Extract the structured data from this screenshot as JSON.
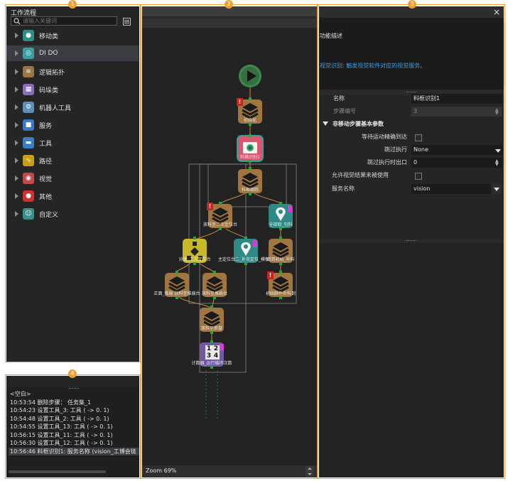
{
  "badges": [
    "1",
    "2",
    "3",
    "4"
  ],
  "workflow": {
    "title": "工作流程",
    "search_placeholder": "请输入关键词",
    "items": [
      {
        "label": "移动类",
        "icon": "location-pin-icon",
        "color": "#2f8f86"
      },
      {
        "label": "DI DO",
        "icon": "dido-icon",
        "color": "#3aa0a0"
      },
      {
        "label": "逻辑拓扑",
        "icon": "layers-icon",
        "color": "#9a7443"
      },
      {
        "label": "码垛类",
        "icon": "palletize-icon",
        "color": "#8a6bb8"
      },
      {
        "label": "机器人工具",
        "icon": "robot-tool-icon",
        "color": "#5e8fb8"
      },
      {
        "label": "服务",
        "icon": "service-icon",
        "color": "#3b78c4"
      },
      {
        "label": "工具",
        "icon": "toolbox-icon",
        "color": "#3a7fbf"
      },
      {
        "label": "路径",
        "icon": "path-icon",
        "color": "#c8a018"
      },
      {
        "label": "视觉",
        "icon": "vision-camera-icon",
        "color": "#c04a4a"
      },
      {
        "label": "其他",
        "icon": "other-icon",
        "color": "#d03030"
      },
      {
        "label": "自定义",
        "icon": "custom-user-icon",
        "color": "#3a8f86"
      }
    ]
  },
  "canvas": {
    "zoom_label": "Zoom 69%",
    "nodes": [
      {
        "label": "初始化"
      },
      {
        "label": "料箱识别1"
      },
      {
        "label": "料框跟踪"
      },
      {
        "label": "放料至二次定位台"
      },
      {
        "label": "全部取_包料"
      },
      {
        "label": "分类_二次定位台"
      },
      {
        "label": "主定位台二_补充定位_模板台"
      },
      {
        "label": "回到初始_补料"
      },
      {
        "label": "正面_推扁 放料至推扁台"
      },
      {
        "label": "放料至推扁台"
      },
      {
        "label": "初始脚件补料到"
      },
      {
        "label": "放料至抓盘"
      },
      {
        "label": "计数器_运行循环次数"
      }
    ],
    "counter_digits": [
      "1",
      "2",
      "3",
      "4"
    ]
  },
  "properties": {
    "section_title": "功能描述",
    "description": "视觉识别: 触发视觉软件对应的视觉服务。",
    "rows": {
      "name_label": "名称",
      "name_value": "料框识别1",
      "step_label": "步骤编号",
      "step_value": "3",
      "group_label": "非移动步骤基本参数",
      "wait_label": "等待运动精确到达",
      "skip_label": "跳过执行",
      "skip_value": "None",
      "skip_exit_label": "跳过执行时出口",
      "skip_exit_value": "0",
      "allow_label": "允许视觉结果未被使用",
      "service_label": "服务名称",
      "service_value": "vision"
    }
  },
  "log": {
    "lines": [
      "<空白>",
      "10:53:54 删除步骤： 任务集_1",
      "10:54:23 设置工具_3: 工具 ( -> 0. 1)",
      "10:54:48 设置工具_2: 工具 ( -> 0. 1)",
      "10:54:55 设置工具_13: 工具 ( -> 0. 1)",
      "10:56:15 设置工具_11: 工具 ( -> 0. 1)",
      "10:56:30 设置工具_12: 工具 ( -> 0. 1)",
      "10:56:46 料框识别1: 服务名称 (vision_工博会链"
    ]
  }
}
